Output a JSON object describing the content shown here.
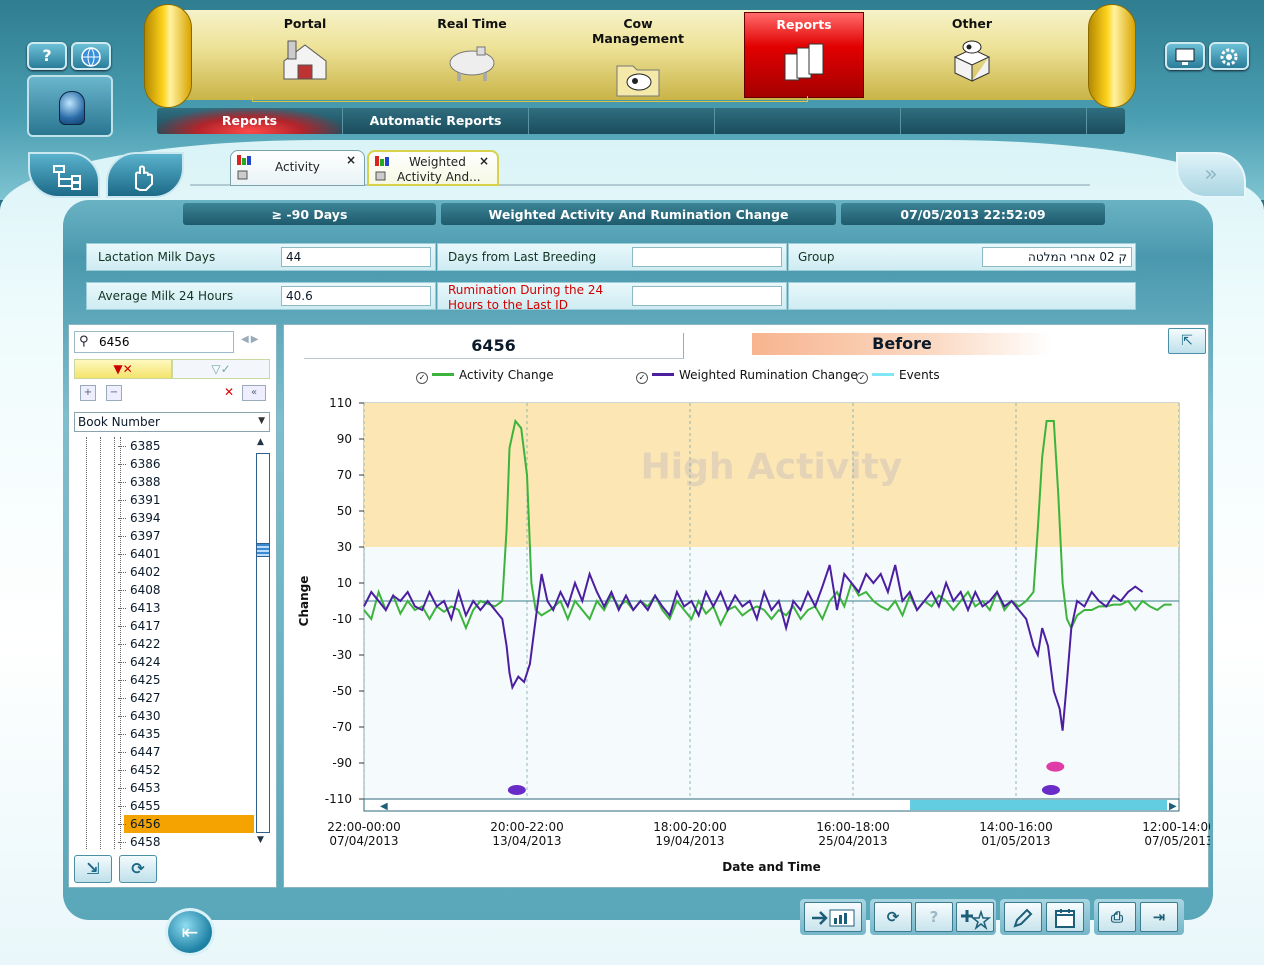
{
  "top_menu": {
    "items": [
      {
        "label": "Portal",
        "icon": "barn-icon"
      },
      {
        "label": "Real Time",
        "icon": "milk-tank-icon"
      },
      {
        "label": "Cow Management",
        "icon": "cow-folder-icon"
      },
      {
        "label": "Reports",
        "icon": "reports-icon",
        "active": true
      },
      {
        "label": "Other",
        "icon": "cow-box-icon"
      }
    ],
    "sub_items": [
      "Reports",
      "Automatic Reports",
      "",
      "",
      ""
    ],
    "help_label": "?"
  },
  "tabs": [
    {
      "label": "Activity",
      "close": "×"
    },
    {
      "label_line1": "Weighted",
      "label_line2": "Activity And...",
      "close": "×"
    }
  ],
  "header_bars": {
    "range": "≥ -90 Days",
    "report_title": "Weighted Activity And Rumination Change",
    "datetime": "07/05/2013 22:52:09"
  },
  "info": {
    "lactation_label": "Lactation Milk Days",
    "lactation_value": "44",
    "days_breeding_label": "Days from Last Breeding",
    "days_breeding_value": "",
    "group_label": "Group",
    "group_value": "ק 02 אחרי המלטה",
    "avg_milk_label": "Average Milk 24 Hours",
    "avg_milk_value": "40.6",
    "rumination_label_line1": "Rumination During the 24",
    "rumination_label_line2": "Hours to the Last ID",
    "rumination_value": ""
  },
  "list_panel": {
    "search_value": "6456",
    "sort_field": "Book Number",
    "items": [
      "6385",
      "6386",
      "6388",
      "6391",
      "6394",
      "6397",
      "6401",
      "6402",
      "6408",
      "6413",
      "6417",
      "6422",
      "6424",
      "6425",
      "6427",
      "6430",
      "6435",
      "6447",
      "6452",
      "6453",
      "6455",
      "6456",
      "6458"
    ],
    "selected": "6456"
  },
  "chart_panel": {
    "cow_id": "6456",
    "state": "Before",
    "legend": [
      "Activity Change",
      "Weighted Rumination Change",
      "Events"
    ],
    "colors": {
      "activity": "#3cb43c",
      "rumination": "#4b1fa0",
      "events": "#7fe7f5",
      "high_band": "#fbe6b4",
      "watermark": "#e4d3b6"
    }
  },
  "chart_data": {
    "type": "line",
    "title": "",
    "xlabel": "Date and Time",
    "ylabel": "Change",
    "ylim": [
      -110,
      110
    ],
    "yticks": [
      110,
      90,
      70,
      50,
      30,
      10,
      -10,
      -30,
      -50,
      -70,
      -90,
      -110
    ],
    "xticks": [
      {
        "line1": "22:00-00:00",
        "line2": "07/04/2013"
      },
      {
        "line1": "20:00-22:00",
        "line2": "13/04/2013"
      },
      {
        "line1": "18:00-20:00",
        "line2": "19/04/2013"
      },
      {
        "line1": "16:00-18:00",
        "line2": "25/04/2013"
      },
      {
        "line1": "14:00-16:00",
        "line2": "01/05/2013"
      },
      {
        "line1": "12:00-14:00",
        "line2": "07/05/2013"
      }
    ],
    "high_band": {
      "from": 30,
      "to": 110,
      "label": "High Activity"
    },
    "x_domain": [
      0,
      5
    ],
    "series": [
      {
        "name": "Activity Change",
        "color": "#3cb43c",
        "points": [
          [
            0,
            -5
          ],
          [
            0.05,
            -10
          ],
          [
            0.1,
            5
          ],
          [
            0.15,
            -5
          ],
          [
            0.2,
            3
          ],
          [
            0.25,
            -7
          ],
          [
            0.3,
            0
          ],
          [
            0.35,
            -5
          ],
          [
            0.4,
            -3
          ],
          [
            0.45,
            -10
          ],
          [
            0.5,
            -3
          ],
          [
            0.55,
            -6
          ],
          [
            0.6,
            -3
          ],
          [
            0.65,
            -5
          ],
          [
            0.7,
            -15
          ],
          [
            0.75,
            -5
          ],
          [
            0.8,
            0
          ],
          [
            0.9,
            -3
          ],
          [
            0.95,
            0
          ],
          [
            0.98,
            40
          ],
          [
            1.0,
            85
          ],
          [
            1.04,
            100
          ],
          [
            1.08,
            96
          ],
          [
            1.12,
            70
          ],
          [
            1.15,
            10
          ],
          [
            1.18,
            -5
          ],
          [
            1.22,
            -8
          ],
          [
            1.28,
            -5
          ],
          [
            1.35,
            0
          ],
          [
            1.4,
            -10
          ],
          [
            1.45,
            0
          ],
          [
            1.5,
            -5
          ],
          [
            1.55,
            -10
          ],
          [
            1.6,
            0
          ],
          [
            1.65,
            -5
          ],
          [
            1.7,
            3
          ],
          [
            1.75,
            -3
          ],
          [
            1.8,
            0
          ],
          [
            1.85,
            -5
          ],
          [
            1.9,
            0
          ],
          [
            1.95,
            -3
          ],
          [
            2.0,
            3
          ],
          [
            2.05,
            -5
          ],
          [
            2.1,
            -10
          ],
          [
            2.15,
            0
          ],
          [
            2.2,
            -5
          ],
          [
            2.25,
            -10
          ],
          [
            2.3,
            0
          ],
          [
            2.35,
            -7
          ],
          [
            2.4,
            -3
          ],
          [
            2.45,
            -13
          ],
          [
            2.5,
            -5
          ],
          [
            2.55,
            -3
          ],
          [
            2.6,
            -8
          ],
          [
            2.65,
            -5
          ],
          [
            2.7,
            -3
          ],
          [
            2.75,
            -5
          ],
          [
            2.8,
            -10
          ],
          [
            2.85,
            -5
          ],
          [
            2.9,
            -8
          ],
          [
            2.95,
            -3
          ],
          [
            3.0,
            -10
          ],
          [
            3.05,
            -5
          ],
          [
            3.1,
            -3
          ],
          [
            3.15,
            -10
          ],
          [
            3.2,
            0
          ],
          [
            3.25,
            5
          ],
          [
            3.3,
            -3
          ],
          [
            3.35,
            10
          ],
          [
            3.4,
            3
          ],
          [
            3.45,
            5
          ],
          [
            3.5,
            0
          ],
          [
            3.55,
            -3
          ],
          [
            3.6,
            -5
          ],
          [
            3.65,
            0
          ],
          [
            3.7,
            -8
          ],
          [
            3.75,
            3
          ],
          [
            3.8,
            -5
          ],
          [
            3.85,
            0
          ],
          [
            3.9,
            -3
          ],
          [
            3.95,
            3
          ],
          [
            4.0,
            0
          ],
          [
            4.05,
            -5
          ],
          [
            4.1,
            0
          ],
          [
            4.15,
            5
          ],
          [
            4.2,
            -3
          ],
          [
            4.25,
            0
          ],
          [
            4.3,
            -5
          ],
          [
            4.35,
            5
          ],
          [
            4.4,
            -5
          ],
          [
            4.45,
            0
          ],
          [
            4.5,
            -3
          ],
          [
            4.55,
            0
          ],
          [
            4.6,
            5
          ],
          [
            4.63,
            40
          ],
          [
            4.66,
            80
          ],
          [
            4.69,
            100
          ],
          [
            4.74,
            100
          ],
          [
            4.77,
            60
          ],
          [
            4.8,
            10
          ],
          [
            4.83,
            -10
          ],
          [
            4.86,
            -15
          ],
          [
            4.9,
            -8
          ],
          [
            4.95,
            -5
          ],
          [
            5.0,
            -5
          ],
          [
            5.05,
            -3
          ],
          [
            5.1,
            -3
          ],
          [
            5.15,
            -2
          ],
          [
            5.2,
            -2
          ],
          [
            5.25,
            0
          ],
          [
            5.3,
            -5
          ],
          [
            5.35,
            0
          ],
          [
            5.4,
            -3
          ],
          [
            5.45,
            -5
          ],
          [
            5.5,
            -2
          ],
          [
            5.55,
            -2
          ]
        ]
      },
      {
        "name": "Weighted Rumination Change",
        "color": "#4b1fa0",
        "points": [
          [
            0,
            -3
          ],
          [
            0.05,
            5
          ],
          [
            0.1,
            0
          ],
          [
            0.15,
            -5
          ],
          [
            0.2,
            3
          ],
          [
            0.25,
            0
          ],
          [
            0.3,
            5
          ],
          [
            0.35,
            -3
          ],
          [
            0.4,
            -5
          ],
          [
            0.45,
            5
          ],
          [
            0.5,
            -3
          ],
          [
            0.55,
            0
          ],
          [
            0.6,
            -10
          ],
          [
            0.65,
            5
          ],
          [
            0.7,
            -8
          ],
          [
            0.75,
            0
          ],
          [
            0.8,
            -5
          ],
          [
            0.85,
            0
          ],
          [
            0.9,
            -5
          ],
          [
            0.95,
            -10
          ],
          [
            0.98,
            -25
          ],
          [
            1.0,
            -40
          ],
          [
            1.02,
            -48
          ],
          [
            1.06,
            -42
          ],
          [
            1.1,
            -45
          ],
          [
            1.14,
            -35
          ],
          [
            1.18,
            -10
          ],
          [
            1.22,
            15
          ],
          [
            1.26,
            0
          ],
          [
            1.3,
            -5
          ],
          [
            1.35,
            5
          ],
          [
            1.4,
            -3
          ],
          [
            1.45,
            10
          ],
          [
            1.5,
            0
          ],
          [
            1.55,
            15
          ],
          [
            1.6,
            5
          ],
          [
            1.65,
            -3
          ],
          [
            1.7,
            5
          ],
          [
            1.75,
            -5
          ],
          [
            1.8,
            3
          ],
          [
            1.85,
            -5
          ],
          [
            1.9,
            0
          ],
          [
            1.95,
            -5
          ],
          [
            2.0,
            3
          ],
          [
            2.05,
            -3
          ],
          [
            2.1,
            -8
          ],
          [
            2.15,
            5
          ],
          [
            2.2,
            -3
          ],
          [
            2.25,
            0
          ],
          [
            2.3,
            -8
          ],
          [
            2.35,
            5
          ],
          [
            2.4,
            -3
          ],
          [
            2.45,
            5
          ],
          [
            2.5,
            -5
          ],
          [
            2.55,
            3
          ],
          [
            2.6,
            -3
          ],
          [
            2.65,
            0
          ],
          [
            2.7,
            -10
          ],
          [
            2.75,
            5
          ],
          [
            2.8,
            -5
          ],
          [
            2.85,
            0
          ],
          [
            2.9,
            -15
          ],
          [
            2.95,
            0
          ],
          [
            3.0,
            -5
          ],
          [
            3.05,
            5
          ],
          [
            3.1,
            -3
          ],
          [
            3.15,
            8
          ],
          [
            3.2,
            20
          ],
          [
            3.25,
            -5
          ],
          [
            3.3,
            15
          ],
          [
            3.35,
            10
          ],
          [
            3.4,
            5
          ],
          [
            3.45,
            15
          ],
          [
            3.5,
            10
          ],
          [
            3.55,
            15
          ],
          [
            3.6,
            5
          ],
          [
            3.65,
            20
          ],
          [
            3.7,
            0
          ],
          [
            3.75,
            5
          ],
          [
            3.8,
            -5
          ],
          [
            3.85,
            0
          ],
          [
            3.9,
            5
          ],
          [
            3.95,
            -3
          ],
          [
            4.0,
            10
          ],
          [
            4.05,
            0
          ],
          [
            4.1,
            5
          ],
          [
            4.15,
            -5
          ],
          [
            4.2,
            5
          ],
          [
            4.25,
            -3
          ],
          [
            4.3,
            0
          ],
          [
            4.35,
            5
          ],
          [
            4.4,
            -3
          ],
          [
            4.45,
            0
          ],
          [
            4.5,
            -5
          ],
          [
            4.55,
            -10
          ],
          [
            4.6,
            -25
          ],
          [
            4.63,
            -30
          ],
          [
            4.66,
            -15
          ],
          [
            4.7,
            -25
          ],
          [
            4.74,
            -50
          ],
          [
            4.78,
            -60
          ],
          [
            4.8,
            -72
          ],
          [
            4.83,
            -45
          ],
          [
            4.86,
            -15
          ],
          [
            4.9,
            0
          ],
          [
            4.95,
            -3
          ],
          [
            5.0,
            5
          ],
          [
            5.05,
            0
          ],
          [
            5.1,
            -3
          ],
          [
            5.15,
            3
          ],
          [
            5.2,
            0
          ],
          [
            5.25,
            5
          ],
          [
            5.3,
            8
          ],
          [
            5.35,
            5
          ]
        ]
      }
    ],
    "events": [
      {
        "x": 1.05,
        "y": -105,
        "color": "#6a2cc8"
      },
      {
        "x": 4.75,
        "y": -92,
        "color": "#e03ca8"
      },
      {
        "x": 4.72,
        "y": -105,
        "color": "#6a2cc8"
      }
    ]
  },
  "toolbar": {
    "refresh": "⟳",
    "help": "?",
    "print": "⎙",
    "export": "⇥"
  }
}
